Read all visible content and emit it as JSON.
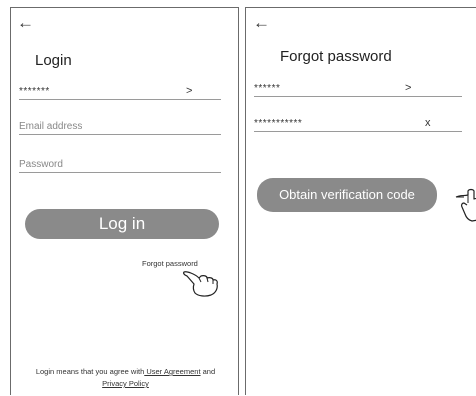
{
  "login": {
    "back_glyph": "←",
    "title": "Login",
    "account": {
      "value": "*******",
      "suffix": ">"
    },
    "email": {
      "placeholder": "Email address"
    },
    "password": {
      "placeholder": "Password"
    },
    "login_button": "Log in",
    "forgot_link": "Forgot password",
    "footer": {
      "prefix": "Login means that you agree with",
      "agreement": " User Agreement",
      "and": " and",
      "privacy": "Privacy Policy"
    }
  },
  "forgot": {
    "back_glyph": "←",
    "title": "Forgot password",
    "account": {
      "value": "******",
      "suffix": ">"
    },
    "email": {
      "value": "***********",
      "suffix": "x"
    },
    "obtain_button": "Obtain verification code"
  },
  "icons": {
    "login_back": "back-arrow-icon",
    "forgot_back": "back-arrow-icon",
    "pointer_login": "hand-pointer-icon",
    "pointer_forgot": "hand-pointer-icon"
  },
  "colors": {
    "button_bg": "#8a8a8a",
    "border": "#6b6b6b"
  }
}
